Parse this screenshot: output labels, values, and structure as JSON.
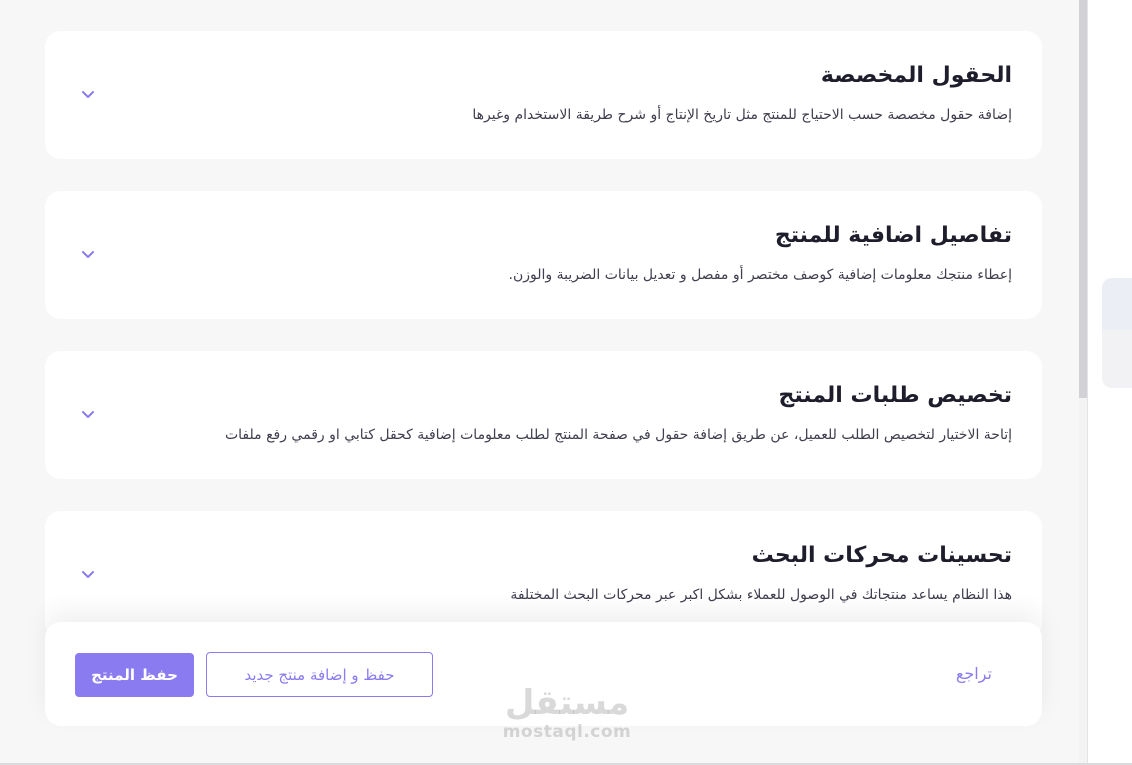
{
  "sections": [
    {
      "title": "الحقول المخصصة",
      "description": "إضافة حقول مخصصة حسب الاحتياج للمنتج مثل تاريخ الإنتاج أو شرح طريقة الاستخدام وغيرها",
      "icon": "chevron-down-icon"
    },
    {
      "title": "تفاصيل اضافية للمنتج",
      "description": "إعطاء منتجك معلومات إضافية كوصف مختصر أو مفصل و تعديل بيانات الضريبة والوزن.",
      "icon": "chevron-down-icon"
    },
    {
      "title": "تخصيص طلبات المنتج",
      "description": "إتاحة الاختيار لتخصيص الطلب للعميل، عن طريق إضافة حقول في صفحة المنتج لطلب معلومات إضافية كحقل كتابي او رقمي رفع ملفات",
      "icon": "chevron-down-icon"
    },
    {
      "title": "تحسينات محركات البحث",
      "description": "هذا النظام يساعد منتجاتك في الوصول للعملاء بشكل اكبر عبر محركات البحث المختلفة",
      "icon": "chevron-down-icon"
    }
  ],
  "footer": {
    "save_label": "حفظ المنتج",
    "save_and_new_label": "حفظ و إضافة منتج جديد",
    "back_label": "تراجع"
  },
  "watermark": {
    "arabic": "مستقل",
    "latin": "mostaql.com"
  },
  "colors": {
    "accent": "#8a7cf0",
    "background": "#f7f7f8",
    "card": "#ffffff",
    "title_text": "#1d1d2b",
    "body_text": "#3e3e4e"
  }
}
